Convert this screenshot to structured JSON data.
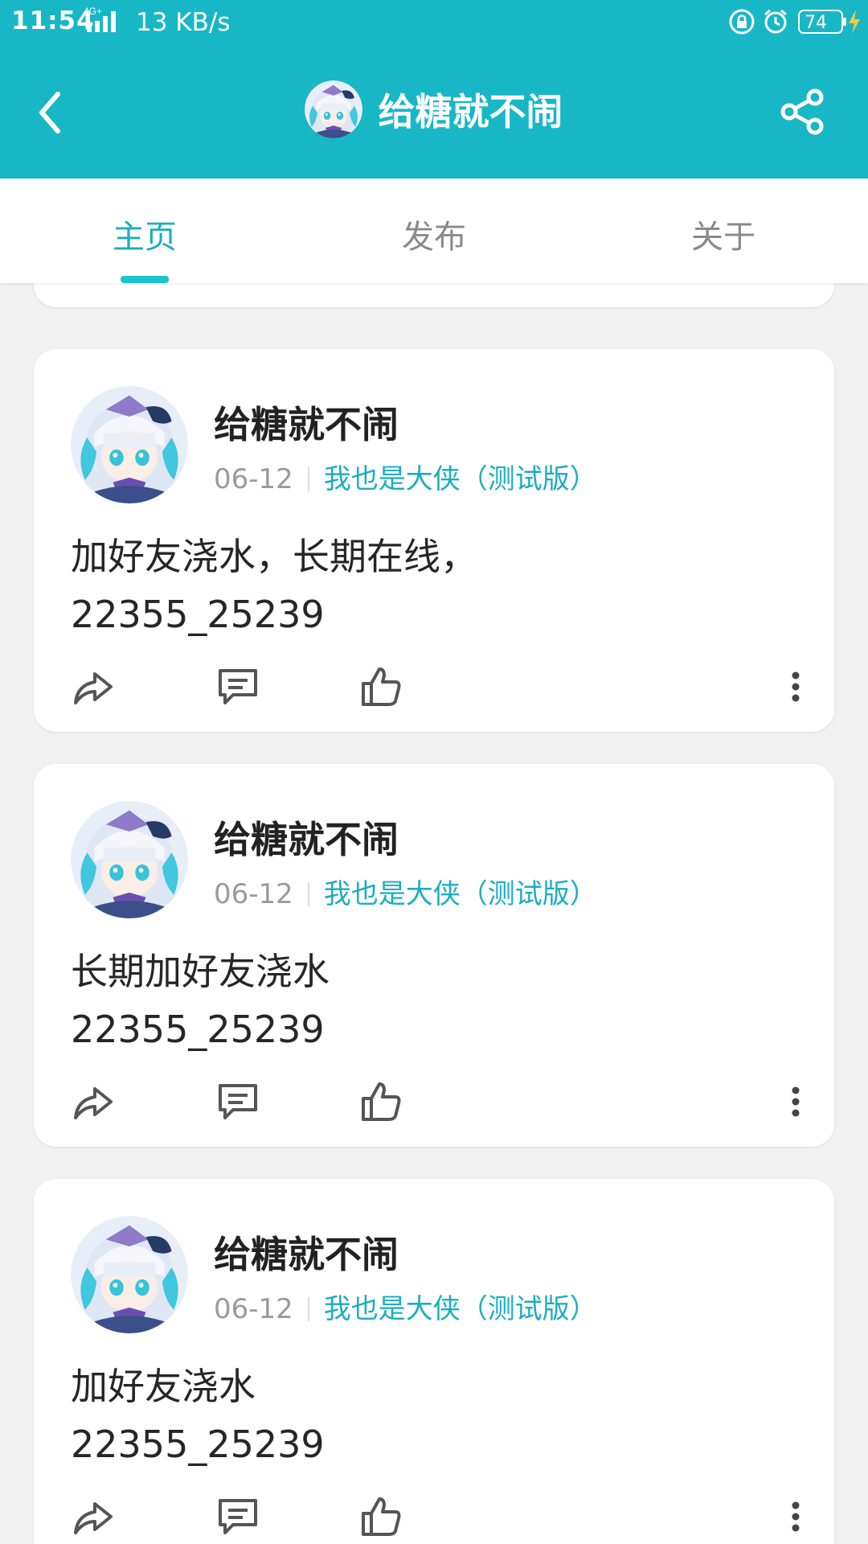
{
  "status_bar": {
    "time": "11:54",
    "network": "4G+",
    "speed": "13 KB/s",
    "battery": "74",
    "icons": [
      "signal-icon",
      "lock-rotation-icon",
      "alarm-icon",
      "battery-icon",
      "charging-icon"
    ]
  },
  "app_bar": {
    "title": "给糖就不闹",
    "back_icon": "chevron-left-icon",
    "share_icon": "share-icon"
  },
  "tabs": [
    {
      "label": "主页",
      "active": true
    },
    {
      "label": "发布",
      "active": false
    },
    {
      "label": "关于",
      "active": false
    }
  ],
  "posts": [
    {
      "author": "给糖就不闹",
      "date": "06-12",
      "game": "我也是大侠（测试版）",
      "line1": "加好友浇水，长期在线，",
      "line2": "22355_25239"
    },
    {
      "author": "给糖就不闹",
      "date": "06-12",
      "game": "我也是大侠（测试版）",
      "line1": "长期加好友浇水",
      "line2": "22355_25239"
    },
    {
      "author": "给糖就不闹",
      "date": "06-12",
      "game": "我也是大侠（测试版）",
      "line1": "加好友浇水",
      "line2": "22355_25239"
    }
  ],
  "colors": {
    "header": "#18b7c6",
    "accent": "#1aaec0",
    "background": "#f1f1f1"
  }
}
